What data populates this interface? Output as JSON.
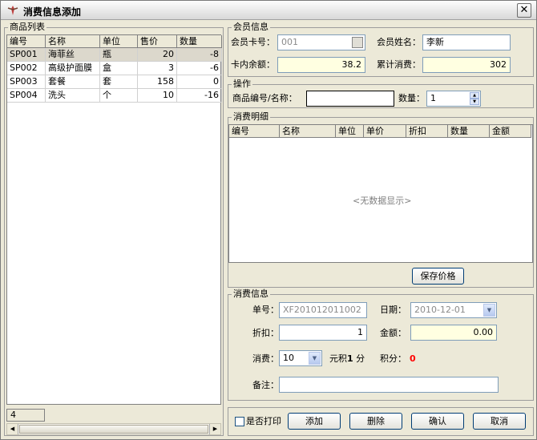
{
  "window": {
    "title": "消费信息添加",
    "close_glyph": "✕"
  },
  "product_list": {
    "label": "商品列表",
    "columns": [
      "编号",
      "名称",
      "单位",
      "售价",
      "数量"
    ],
    "rows": [
      [
        "SP001",
        "海菲丝",
        "瓶",
        "20",
        "-8"
      ],
      [
        "SP002",
        "高级护面膜",
        "盒",
        "3",
        "-6"
      ],
      [
        "SP003",
        "套餐",
        "套",
        "158",
        "0"
      ],
      [
        "SP004",
        "洗头",
        "个",
        "10",
        "-16"
      ]
    ],
    "count": "4"
  },
  "member": {
    "label": "会员信息",
    "card_label": "会员卡号：",
    "card_value": "001",
    "name_label": "会员姓名：",
    "name_value": "李新",
    "balance_label": "卡内余额：",
    "balance_value": "38.2",
    "total_label": "累计消费：",
    "total_value": "302"
  },
  "operation": {
    "label": "操作",
    "code_label": "商品编号/名称：",
    "code_value": "",
    "qty_label": "数量：",
    "qty_value": "1"
  },
  "detail": {
    "label": "消费明细",
    "columns": [
      "编号",
      "名称",
      "单位",
      "单价",
      "折扣",
      "数量",
      "金额"
    ],
    "empty_text": "<无数据显示>",
    "save_price_label": "保存价格"
  },
  "consume": {
    "label": "消费信息",
    "order_label": "单号：",
    "order_value": "XF201012011002",
    "date_label": "日期：",
    "date_value": "2010-12-01",
    "discount_label": "折扣：",
    "discount_value": "1",
    "amount_label": "金额：",
    "amount_value": "0.00",
    "consume_label": "消费：",
    "consume_value": "10",
    "yuan_label": "元积",
    "point_unit": "1",
    "fen_label": "分",
    "points_label": "积分：",
    "points_value": "0",
    "note_label": "备注：",
    "note_value": ""
  },
  "footer": {
    "print_label": "是否打印",
    "add_label": "添加",
    "delete_label": "删除",
    "confirm_label": "确认",
    "cancel_label": "取消"
  },
  "colors": {
    "points": "#ff0000",
    "selected_row": "#dcd8cc"
  }
}
